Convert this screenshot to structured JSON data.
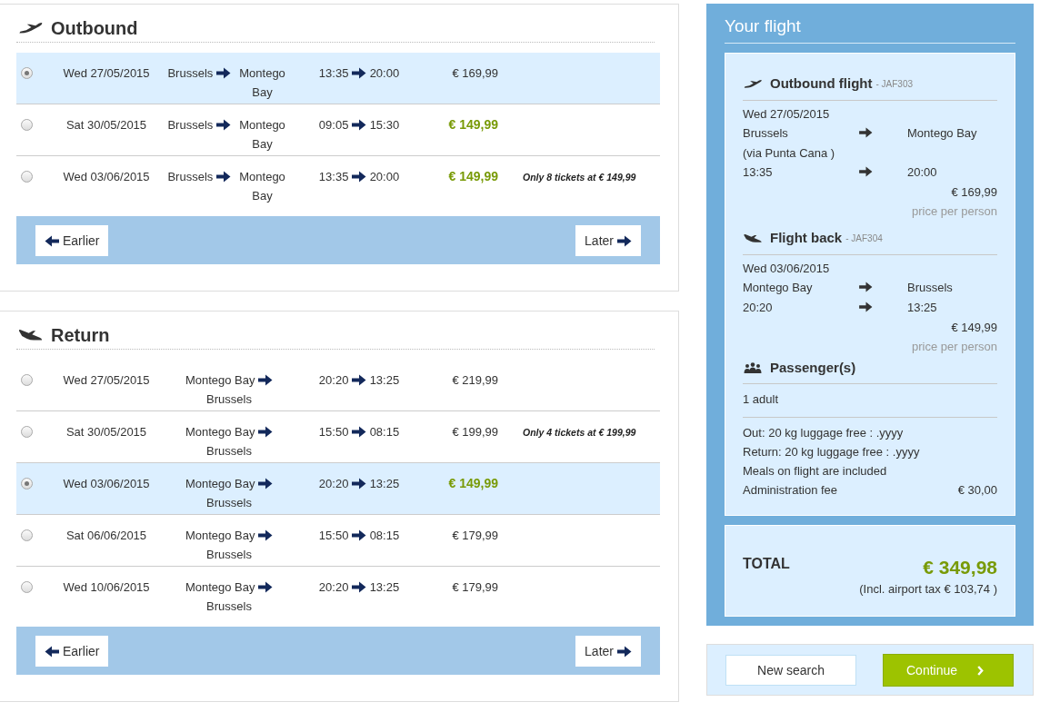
{
  "sections": [
    {
      "kind": "outbound",
      "title": "Outbound",
      "flights": [
        {
          "date": "Wed 27/05/2015",
          "from": "Brussels",
          "to": "Montego Bay",
          "depart": "13:35",
          "arrive": "20:00",
          "price": "€ 169,99",
          "cheapest": false,
          "selected": true
        },
        {
          "date": "Sat 30/05/2015",
          "from": "Brussels",
          "to": "Montego Bay",
          "depart": "09:05",
          "arrive": "15:30",
          "price": "€ 149,99",
          "cheapest": true,
          "selected": false
        },
        {
          "date": "Wed 03/06/2015",
          "from": "Brussels",
          "to": "Montego Bay",
          "depart": "13:35",
          "arrive": "20:00",
          "price": "€ 149,99",
          "cheapest": true,
          "selected": false,
          "note": "Only 8 tickets at € 149,99"
        }
      ],
      "earlier": "Earlier",
      "later": "Later"
    },
    {
      "kind": "return",
      "title": "Return",
      "flights": [
        {
          "date": "Wed 27/05/2015",
          "from": "Montego Bay",
          "to": "Brussels",
          "depart": "20:20",
          "arrive": "13:25",
          "price": "€ 219,99",
          "cheapest": false,
          "selected": false
        },
        {
          "date": "Sat 30/05/2015",
          "from": "Montego Bay",
          "to": "Brussels",
          "depart": "15:50",
          "arrive": "08:15",
          "price": "€ 199,99",
          "cheapest": false,
          "selected": false,
          "note": "Only 4 tickets at € 199,99"
        },
        {
          "date": "Wed 03/06/2015",
          "from": "Montego Bay",
          "to": "Brussels",
          "depart": "20:20",
          "arrive": "13:25",
          "price": "€ 149,99",
          "cheapest": true,
          "selected": true
        },
        {
          "date": "Sat 06/06/2015",
          "from": "Montego Bay",
          "to": "Brussels",
          "depart": "15:50",
          "arrive": "08:15",
          "price": "€ 179,99",
          "cheapest": false,
          "selected": false
        },
        {
          "date": "Wed 10/06/2015",
          "from": "Montego Bay",
          "to": "Brussels",
          "depart": "20:20",
          "arrive": "13:25",
          "price": "€ 179,99",
          "cheapest": false,
          "selected": false
        }
      ],
      "earlier": "Earlier",
      "later": "Later"
    }
  ],
  "summary": {
    "title": "Your flight",
    "legs": [
      {
        "kind": "outbound",
        "title": "Outbound flight",
        "code": "- JAF303",
        "date": "Wed 27/05/2015",
        "from": "Brussels",
        "to": "Montego Bay",
        "via": "(via Punta Cana )",
        "depart": "13:35",
        "arrive": "20:00",
        "price": "€ 169,99",
        "price_note": "price per person"
      },
      {
        "kind": "return",
        "title": "Flight back",
        "code": "- JAF304",
        "date": "Wed 03/06/2015",
        "from": "Montego Bay",
        "to": "Brussels",
        "depart": "20:20",
        "arrive": "13:25",
        "price": "€ 149,99",
        "price_note": "price per person"
      }
    ],
    "passengers": {
      "title": "Passenger(s)",
      "count": "1 adult",
      "items": [
        {
          "text": "Out: 20 kg luggage free : .yyyy"
        },
        {
          "text": "Return: 20 kg luggage free : .yyyy"
        },
        {
          "text": "Meals on flight are included"
        },
        {
          "text": "Administration fee",
          "amount": "€ 30,00"
        }
      ]
    },
    "total": {
      "label": "TOTAL",
      "amount": "€ 349,98",
      "tax_note": "(Incl. airport tax € 103,74 )"
    }
  },
  "actions": {
    "new_search": "New search",
    "continue": "Continue"
  }
}
